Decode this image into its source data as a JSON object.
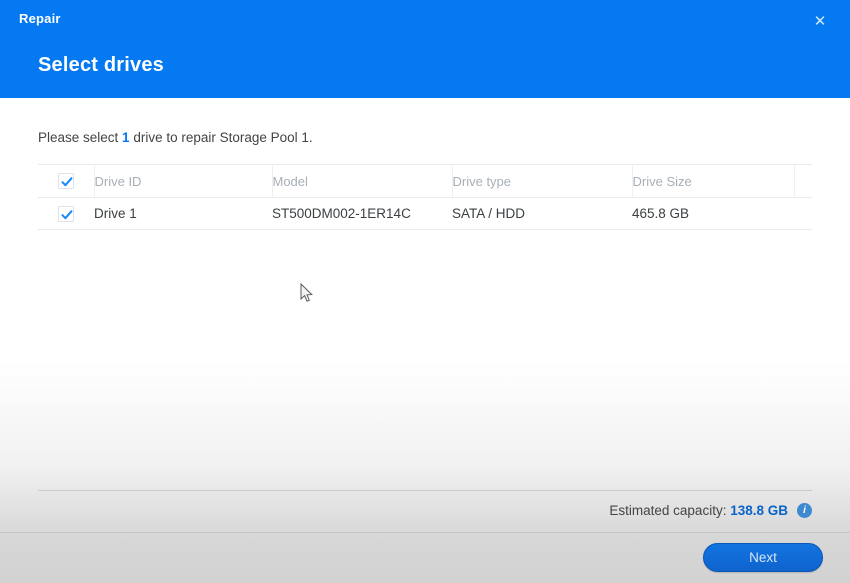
{
  "header": {
    "kicker": "Repair",
    "title": "Select drives",
    "close_label": "✕"
  },
  "main": {
    "instruction_prefix": "Please select ",
    "instruction_count": "1",
    "instruction_suffix": " drive to repair Storage Pool 1."
  },
  "table": {
    "columns": [
      "Drive ID",
      "Model",
      "Drive type",
      "Drive Size"
    ],
    "header_checkbox_checked": true,
    "rows": [
      {
        "checked": true,
        "drive_id": "Drive 1",
        "model": "ST500DM002-1ER14C",
        "drive_type": "SATA / HDD",
        "drive_size": "465.8 GB"
      }
    ]
  },
  "footer": {
    "capacity_label": "Estimated capacity: ",
    "capacity_value": "138.8 GB",
    "info_icon_glyph": "i",
    "next_label": "Next"
  },
  "colors": {
    "header_blue": "#0479f2",
    "link_blue": "#0479f2",
    "capacity_blue": "#0a64c8",
    "button_blue": "#1374e0",
    "check_blue": "#1b8bf9"
  }
}
